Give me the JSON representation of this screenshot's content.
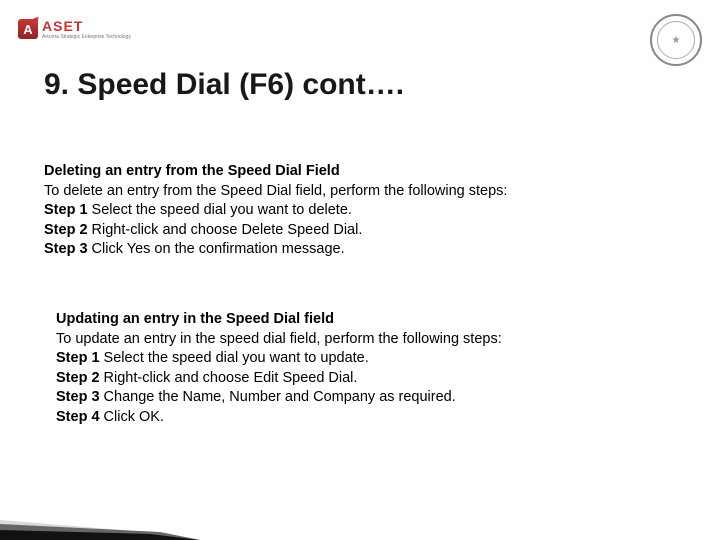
{
  "header": {
    "logo_name": "ASET",
    "logo_tagline": "Arizona Strategic Enterprise Technology"
  },
  "title": "9. Speed Dial (F6) cont….",
  "section1": {
    "heading": "Deleting an entry from the Speed Dial Field",
    "intro": "To delete an entry from the Speed Dial field, perform the following steps:",
    "steps": [
      {
        "label": "Step 1",
        "text": " Select the speed dial you want to delete."
      },
      {
        "label": "Step 2",
        "text": " Right-click and choose Delete Speed Dial."
      },
      {
        "label": "Step 3",
        "text": " Click Yes on the confirmation message."
      }
    ]
  },
  "section2": {
    "heading": "Updating an entry in the Speed Dial field",
    "intro": "To update an entry in the speed dial field, perform the following steps:",
    "steps": [
      {
        "label": "Step 1",
        "text": " Select the speed dial you want to update."
      },
      {
        "label": "Step 2",
        "text": " Right-click and choose Edit Speed Dial."
      },
      {
        "label": "Step 3",
        "text": " Change the Name, Number and Company as required."
      },
      {
        "label": "Step 4",
        "text": " Click OK."
      }
    ]
  }
}
